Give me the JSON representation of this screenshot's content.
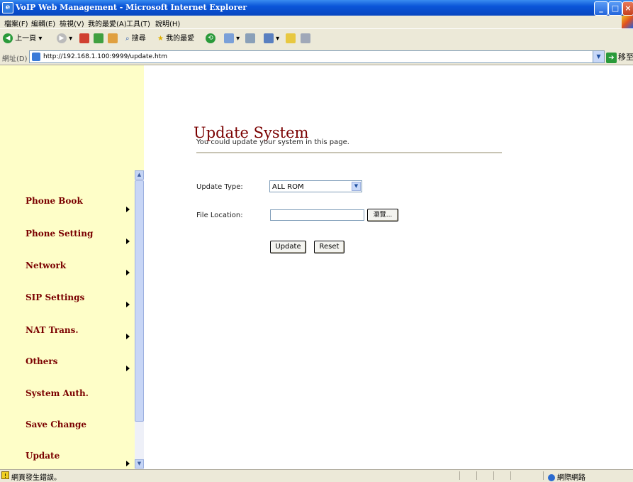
{
  "window": {
    "title": "VoIP Web Management - Microsoft Internet Explorer"
  },
  "menu": [
    "檔案(F)",
    "編輯(E)",
    "檢視(V)",
    "我的最愛(A)",
    "工具(T)",
    "說明(H)"
  ],
  "toolbar": {
    "back_label": "上一頁",
    "search_label": "搜尋",
    "favorites_label": "我的最愛"
  },
  "address": {
    "label": "網址(D)",
    "url": "http://192.168.1.100:9999/update.htm",
    "go_label": "移至"
  },
  "sidebar": {
    "items": [
      {
        "label": "Phone Book",
        "has_arrow": true
      },
      {
        "label": "Phone Setting",
        "has_arrow": true
      },
      {
        "label": "Network",
        "has_arrow": true
      },
      {
        "label": "SIP Settings",
        "has_arrow": true
      },
      {
        "label": "NAT Trans.",
        "has_arrow": true
      },
      {
        "label": "Others",
        "has_arrow": true
      },
      {
        "label": "System Auth.",
        "has_arrow": false
      },
      {
        "label": "Save Change",
        "has_arrow": false
      },
      {
        "label": "Update",
        "has_arrow": true
      }
    ]
  },
  "main": {
    "title": "Update System",
    "description": "You could update your system in this page.",
    "update_type_label": "Update Type:",
    "update_type_value": "ALL ROM",
    "file_location_label": "File Location:",
    "file_location_value": "",
    "browse_label": "瀏覽...",
    "update_button": "Update",
    "reset_button": "Reset"
  },
  "status": {
    "message": "網頁發生錯誤。",
    "zone": "網際網路"
  }
}
